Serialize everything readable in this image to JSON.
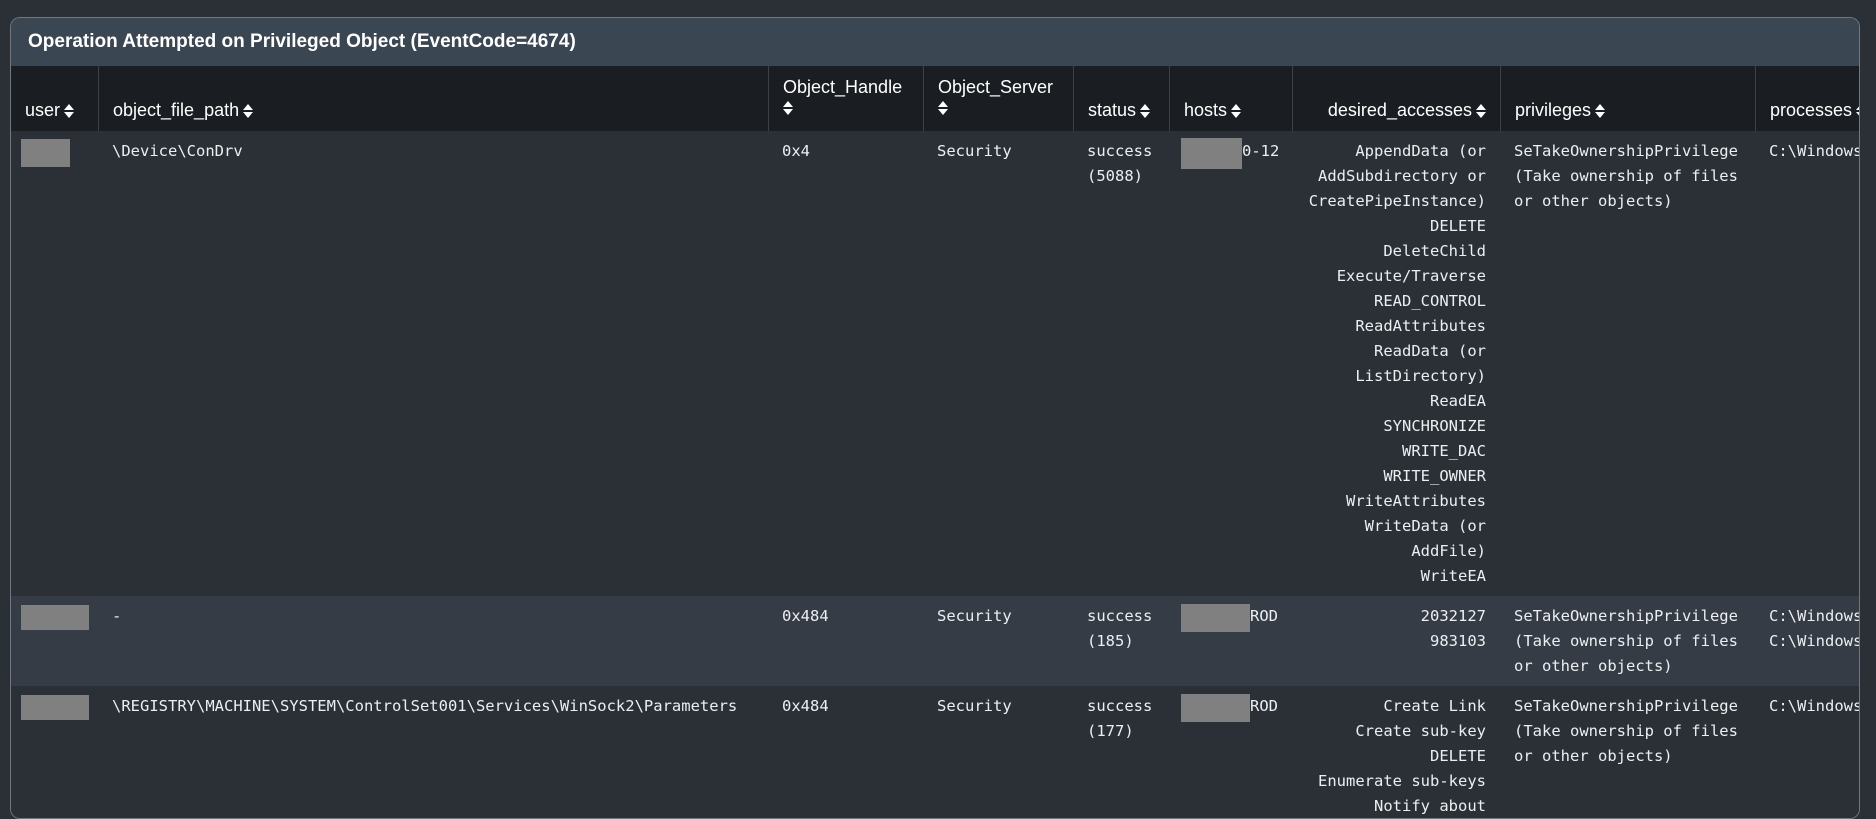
{
  "panel": {
    "title": "Operation Attempted on Privileged Object (EventCode=4674)"
  },
  "columns": {
    "user": "user",
    "object_file_path": "object_file_path",
    "object_handle": "Object_Handle",
    "object_server": "Object_Server",
    "status": "status",
    "hosts": "hosts",
    "desired_accesses": "desired_accesses",
    "privileges": "privileges",
    "processes": "processes"
  },
  "rows": [
    {
      "object_file_path": "\\Device\\ConDrv",
      "object_handle": "0x4",
      "object_server": "Security",
      "status": "success\n(5088)",
      "hosts_suffix": "0-12",
      "desired_accesses": "AppendData (or\nAddSubdirectory or\nCreatePipeInstance)\nDELETE\nDeleteChild\nExecute/Traverse\nREAD_CONTROL\nReadAttributes\nReadData (or\nListDirectory)\nReadEA\nSYNCHRONIZE\nWRITE_DAC\nWRITE_OWNER\nWriteAttributes\nWriteData (or\nAddFile)\nWriteEA",
      "privileges": "SeTakeOwnershipPrivilege\n(Take ownership of files\nor other objects)",
      "processes": "C:\\Windows\\"
    },
    {
      "object_file_path": "-",
      "object_handle": "0x484",
      "object_server": "Security",
      "status": "success\n(185)",
      "hosts_suffix": "ROD",
      "desired_accesses": "2032127\n983103",
      "privileges": "SeTakeOwnershipPrivilege\n(Take ownership of files\nor other objects)",
      "processes": "C:\\Windows\\\nC:\\Windows\\"
    },
    {
      "object_file_path": "\\REGISTRY\\MACHINE\\SYSTEM\\ControlSet001\\Services\\WinSock2\\Parameters",
      "object_handle": "0x484",
      "object_server": "Security",
      "status": "success\n(177)",
      "hosts_suffix": "ROD",
      "desired_accesses": "Create Link\nCreate sub-key\nDELETE\nEnumerate sub-keys\nNotify about",
      "privileges": "SeTakeOwnershipPrivilege\n(Take ownership of files\nor other objects)",
      "processes": "C:\\Windows\\"
    }
  ]
}
